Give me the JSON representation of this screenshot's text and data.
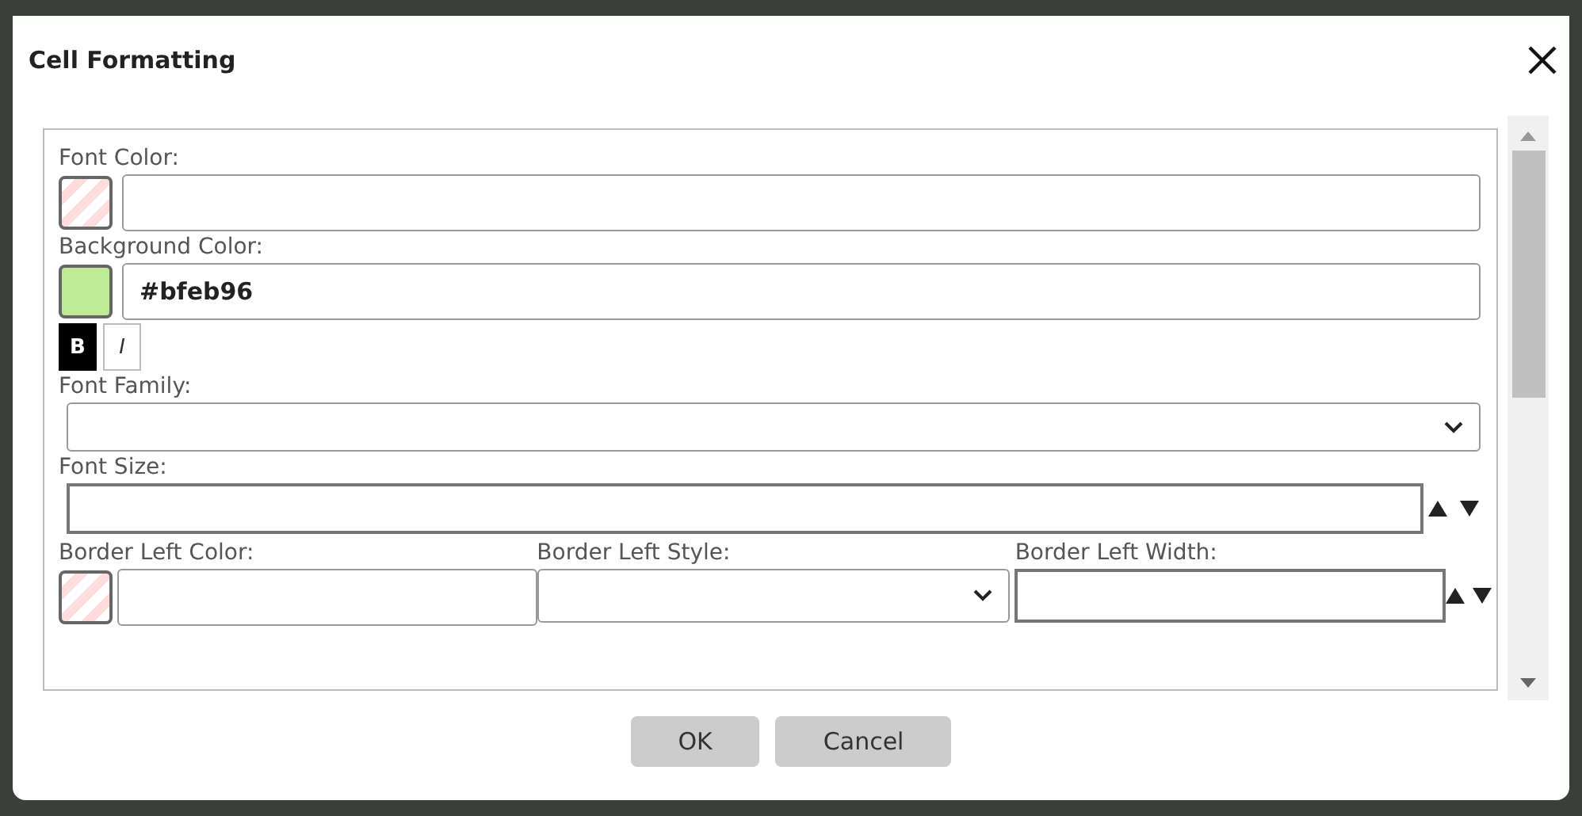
{
  "dialog": {
    "title": "Cell Formatting"
  },
  "fields": [
    {
      "kind": "color",
      "label": "Font Color:"
    },
    {
      "kind": "color",
      "label": "Background Color:",
      "color": "#bfeb96",
      "value": "#bfeb96"
    },
    {
      "kind": "toggles",
      "toggles": [
        {
          "label": "B",
          "kind": "bold",
          "selected": true
        },
        {
          "label": "I",
          "kind": "italic",
          "selected": false
        }
      ]
    },
    {
      "kind": "select",
      "label": "Font Family:"
    },
    {
      "kind": "spinner",
      "label": "Font Size:"
    },
    {
      "kind": "columns",
      "columns": [
        {
          "kind": "color",
          "label": "Border Left Color:"
        },
        {
          "kind": "select",
          "label": "Border Left Style:"
        },
        {
          "kind": "spinner",
          "label": "Border Left Width:"
        }
      ]
    }
  ],
  "buttons": [
    {
      "label": "OK"
    },
    {
      "label": "Cancel"
    }
  ]
}
